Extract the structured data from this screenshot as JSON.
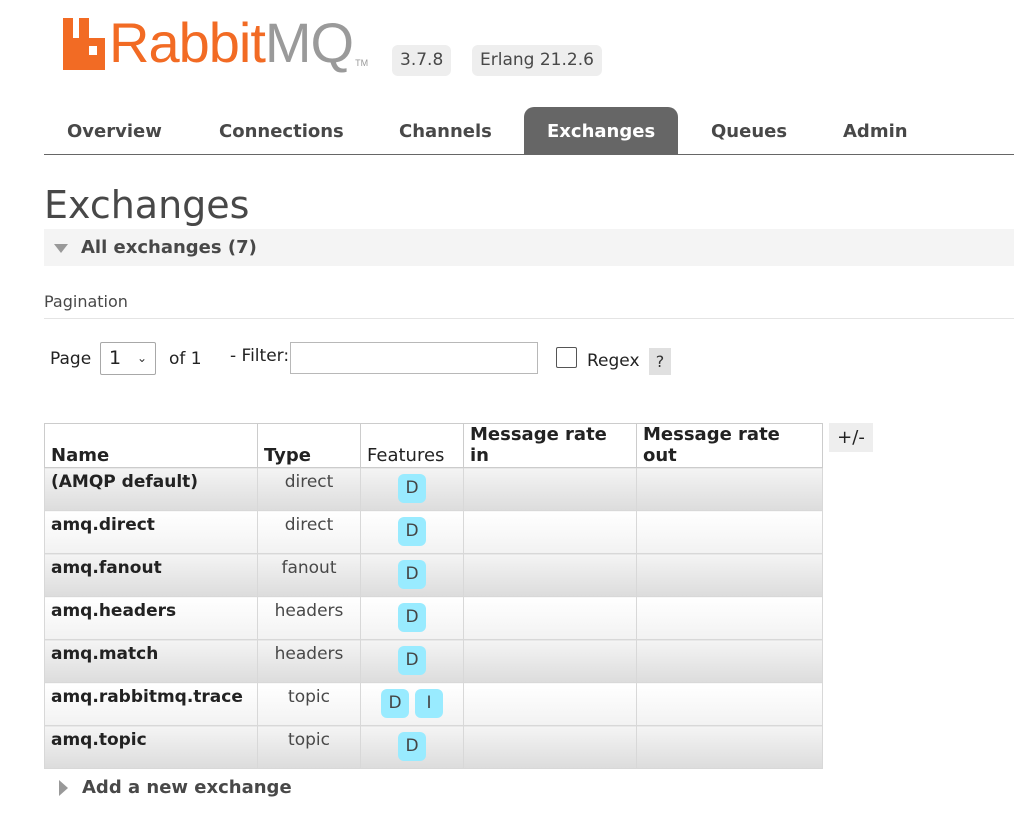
{
  "header": {
    "logo_text": "RabbitMQ",
    "logo_rabbit": "Rabbit",
    "logo_mq": "MQ",
    "logo_tm": "TM",
    "version": "3.7.8",
    "erlang": "Erlang 21.2.6",
    "brand_color": "#f26b24"
  },
  "tabs": [
    {
      "label": "Overview",
      "active": false
    },
    {
      "label": "Connections",
      "active": false
    },
    {
      "label": "Channels",
      "active": false
    },
    {
      "label": "Exchanges",
      "active": true
    },
    {
      "label": "Queues",
      "active": false
    },
    {
      "label": "Admin",
      "active": false
    }
  ],
  "page_title": "Exchanges",
  "section": {
    "title": "All exchanges (7)",
    "pagination_heading": "Pagination"
  },
  "pagination": {
    "page_label": "Page",
    "page_value": "1",
    "of_label": "of 1",
    "filter_label": "- Filter:",
    "filter_value": "",
    "regex_label": "Regex",
    "regex_checked": false,
    "help_label": "?"
  },
  "table": {
    "headers": {
      "name": "Name",
      "type": "Type",
      "features": "Features",
      "rate_in": "Message rate in",
      "rate_out": "Message rate out"
    },
    "toggle_label": "+/-",
    "rows": [
      {
        "name": "(AMQP default)",
        "type": "direct",
        "features": [
          "D"
        ],
        "rate_in": "",
        "rate_out": ""
      },
      {
        "name": "amq.direct",
        "type": "direct",
        "features": [
          "D"
        ],
        "rate_in": "",
        "rate_out": ""
      },
      {
        "name": "amq.fanout",
        "type": "fanout",
        "features": [
          "D"
        ],
        "rate_in": "",
        "rate_out": ""
      },
      {
        "name": "amq.headers",
        "type": "headers",
        "features": [
          "D"
        ],
        "rate_in": "",
        "rate_out": ""
      },
      {
        "name": "amq.match",
        "type": "headers",
        "features": [
          "D"
        ],
        "rate_in": "",
        "rate_out": ""
      },
      {
        "name": "amq.rabbitmq.trace",
        "type": "topic",
        "features": [
          "D",
          "I"
        ],
        "rate_in": "",
        "rate_out": ""
      },
      {
        "name": "amq.topic",
        "type": "topic",
        "features": [
          "D"
        ],
        "rate_in": "",
        "rate_out": ""
      }
    ]
  },
  "add_exchange_label": "Add a new exchange"
}
